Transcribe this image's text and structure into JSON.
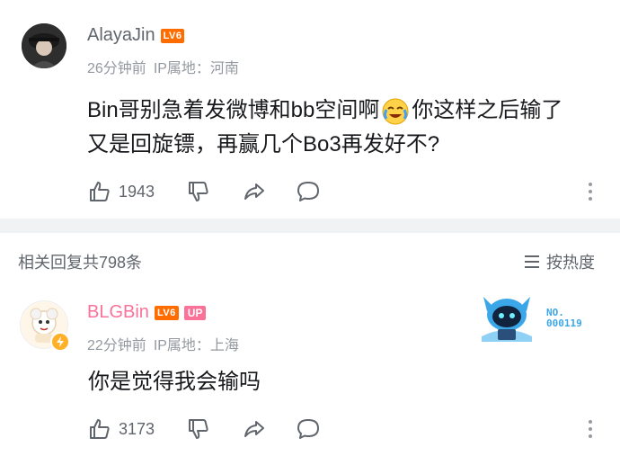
{
  "comment": {
    "username": "AlayaJin",
    "level": "LV6",
    "time": "26分钟前",
    "ip": "IP属地：河南",
    "text_line1_a": "Bin哥别急着发微博和bb空间啊",
    "text_line1_b": "你这样之后输了",
    "text_line2": "又是回旋镖，再赢几个Bo3再发好不?",
    "likes": "1943"
  },
  "replies_header": {
    "count_label": "相关回复共798条",
    "sort_label": "按热度"
  },
  "reply": {
    "username": "BLGBin",
    "level": "LV6",
    "badge": "UP",
    "time": "22分钟前",
    "ip": "IP属地：上海",
    "text": "你是觉得我会输吗",
    "likes": "3173",
    "fan_badge_label": "NO.",
    "fan_badge_number": "000119"
  },
  "colors": {
    "pink": "#fb7299",
    "level_orange": "#ff6c00",
    "gray_text": "#9499a0",
    "divider": "#f1f2f3"
  }
}
